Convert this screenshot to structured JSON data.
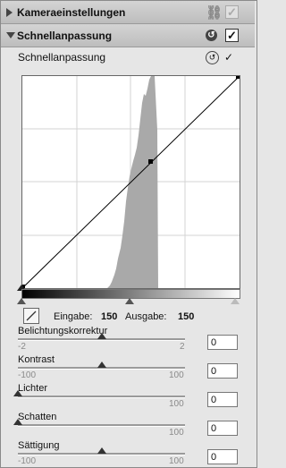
{
  "panels": {
    "camera": {
      "title": "Kameraeinstellungen",
      "check": "✓"
    },
    "quick": {
      "title": "Schnellanpassung",
      "reset_icon": "↺",
      "check": "✓"
    }
  },
  "subsection": {
    "title": "Schnellanpassung",
    "reset_icon": "↺",
    "check": "✓"
  },
  "curve_io": {
    "input_label": "Eingabe:",
    "input_value": "150",
    "output_label": "Ausgabe:",
    "output_value": "150"
  },
  "sliders": [
    {
      "label": "Belichtungskorrektur",
      "min": "-2",
      "max": "2",
      "value": "0",
      "position": 0.5
    },
    {
      "label": "Kontrast",
      "min": "-100",
      "max": "100",
      "value": "0",
      "position": 0.5
    },
    {
      "label": "Lichter",
      "min": "",
      "max": "100",
      "value": "0",
      "position": 0.0
    },
    {
      "label": "Schatten",
      "min": "",
      "max": "100",
      "value": "0",
      "position": 0.0
    },
    {
      "label": "Sättigung",
      "min": "-100",
      "max": "100",
      "value": "0",
      "position": 0.5
    }
  ],
  "colors": {
    "histogram": "#a9a9a9",
    "grid": "#d3d3d3"
  }
}
